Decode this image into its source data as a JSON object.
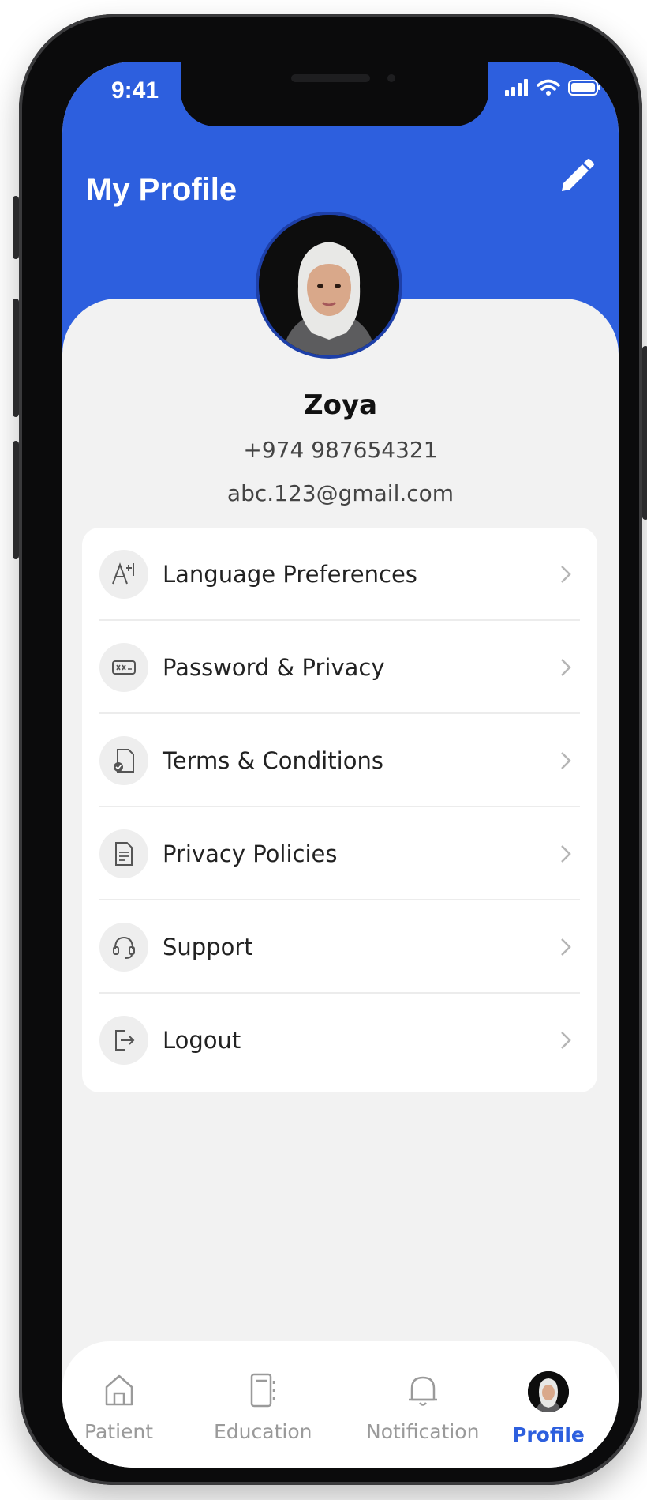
{
  "status_bar": {
    "time": "9:41"
  },
  "header": {
    "title": "My Profile"
  },
  "profile": {
    "name": "Zoya",
    "phone": "+974 987654321",
    "email": "abc.123@gmail.com"
  },
  "menu": {
    "items": [
      {
        "label": "Language Preferences",
        "icon": "language-icon"
      },
      {
        "label": "Password & Privacy",
        "icon": "password-icon"
      },
      {
        "label": "Terms & Conditions",
        "icon": "terms-document-icon"
      },
      {
        "label": "Privacy Policies",
        "icon": "policy-document-icon"
      },
      {
        "label": "Support",
        "icon": "headset-icon"
      },
      {
        "label": "Logout",
        "icon": "logout-icon"
      }
    ]
  },
  "bottom_nav": {
    "items": [
      {
        "label": "Patient",
        "icon": "home-icon"
      },
      {
        "label": "Education",
        "icon": "notebook-icon"
      },
      {
        "label": "Notification",
        "icon": "bell-icon"
      },
      {
        "label": "Profile",
        "icon": "avatar"
      }
    ],
    "active": "Profile"
  },
  "colors": {
    "primary": "#2d5fde",
    "background": "#f2f2f2",
    "card": "#ffffff",
    "text": "#222222",
    "inactive_nav": "#9a9a9a"
  }
}
